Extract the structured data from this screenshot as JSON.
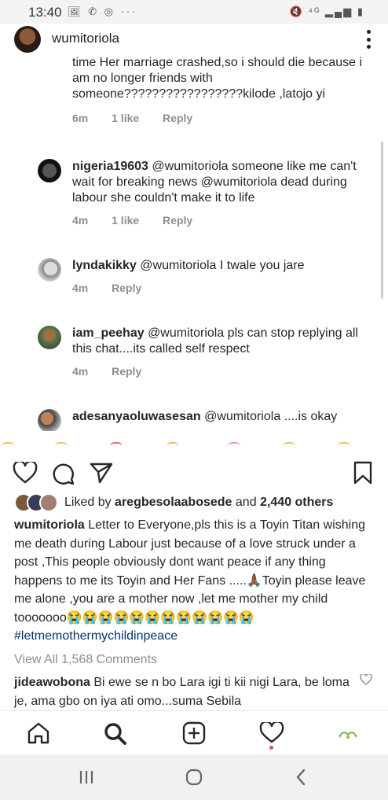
{
  "status_bar": {
    "time": "13:40",
    "dots": "···"
  },
  "header": {
    "username": "wumitoriola"
  },
  "comments": [
    {
      "text": "time Her marriage crashed,so i should die because i am no longer friends with someone?????????????????kilode ,latojo yi",
      "time": "6m",
      "likes": "1 like",
      "reply": "Reply"
    },
    {
      "username": "nigeria19603",
      "text": "@wumitoriola someone like me can't wait for breaking news @wumitoriola dead during labour she couldn't make it to life",
      "time": "4m",
      "likes": "1 like",
      "reply": "Reply"
    },
    {
      "username": "lyndakikky",
      "text": "@wumitoriola I twale you jare",
      "time": "4m",
      "reply": "Reply"
    },
    {
      "username": "iam_peehay",
      "text": "@wumitoriola pls  can stop replying all this chat....its called self respect",
      "time": "4m",
      "reply": "Reply"
    },
    {
      "username": "adesanyaoluwasesan",
      "text": "@wumitoriola ....is okay"
    }
  ],
  "post": {
    "liked_by_prefix": "Liked by ",
    "liked_by_user": "aregbesolaabosede",
    "liked_by_and": " and ",
    "liked_by_others": "2,440 others",
    "caption_user": "wumitoriola",
    "caption_text": "Letter to Everyone,pls this is a Toyin Titan wishing me death  during Labour just because of a love struck under a post ,This people obviously dont want peace if any thing happens to me its Toyin and Her Fans .....🙏🏾Toyin please leave me alone ,you are a mother now ,let me mother my child tooooooo😭😭😭😭😭😭😭😭😭😭😭😭",
    "caption_hashtag": "#letmemothermychildinpeace",
    "view_all": "View All 1,568 Comments",
    "first_comment_user": "jideawobona",
    "first_comment_text": "Bi ewe se n bo Lara igi ti kii nigi Lara, be loma je, ama gbo on iya ati omo...suma Sebila"
  },
  "colors": {
    "like_red": "#ed4956",
    "link": "#00376b",
    "muted": "#8e8e8e"
  }
}
